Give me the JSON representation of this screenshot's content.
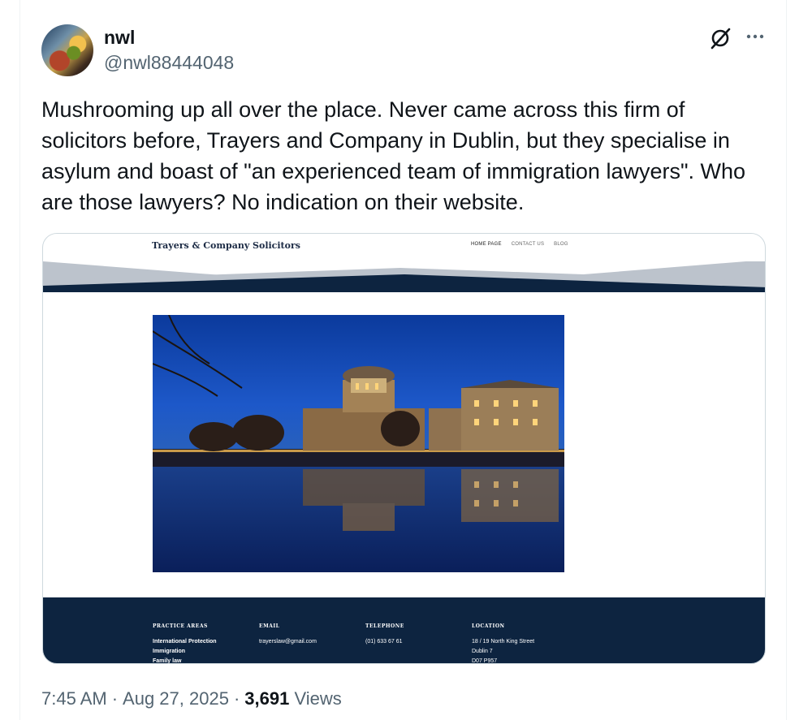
{
  "author": {
    "display_name": "nwl",
    "handle": "@nwl88444048"
  },
  "tweet": {
    "text": "Mushrooming up all over the place. Never came across this firm of solicitors before, Trayers and Company in Dublin, but they specialise in asylum and boast of \"an experienced team of immigration lawyers\". Who are those lawyers? No indication on their website."
  },
  "screenshot": {
    "site_title": "Trayers & Company Solicitors",
    "nav": [
      "HOME PAGE",
      "CONTACT US",
      "BLOG"
    ],
    "footer": {
      "practice": {
        "heading": "PRACTICE AREAS",
        "lines": [
          "International Protection",
          "Immigration",
          "Family law"
        ]
      },
      "email": {
        "heading": "EMAIL",
        "lines": [
          "trayerslaw@gmail.com"
        ]
      },
      "telephone": {
        "heading": "TELEPHONE",
        "lines": [
          "(01) 633 67 61"
        ]
      },
      "location": {
        "heading": "LOCATION",
        "lines": [
          "18 / 19 North King Street",
          "Dublin 7",
          "D07 P957"
        ]
      }
    }
  },
  "meta": {
    "time": "7:45 AM",
    "separator": "·",
    "date": "Aug 27, 2025",
    "views_count": "3,691",
    "views_label": "Views"
  },
  "icons": {
    "grok": "grok-icon",
    "more": "more-icon"
  },
  "colors": {
    "text": "#0f1419",
    "secondary": "#536471",
    "footer_navy": "#0d2440"
  }
}
